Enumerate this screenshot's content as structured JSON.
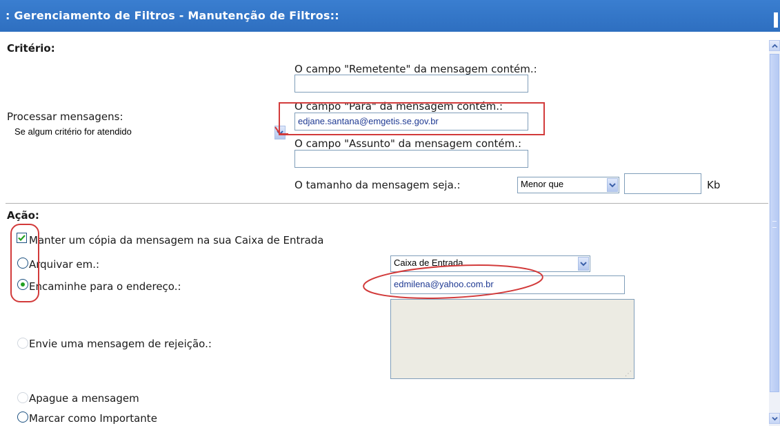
{
  "window": {
    "title": ": Gerenciamento de Filtros - Manutenção de Filtros::"
  },
  "criteria": {
    "header": "Critério:",
    "process_label": "Processar mensagens:",
    "process_value": "Se algum critério for atendido",
    "from_label": "O campo \"Remetente\" da mensagem contém.:",
    "from_value": "",
    "to_label": "O campo \"Para\" da mensagem contém.:",
    "to_value": "edjane.santana@emgetis.se.gov.br",
    "subject_label": "O campo \"Assunto\" da mensagem contém.:",
    "subject_value": "",
    "size_label": "O tamanho da mensagem seja.:",
    "size_comparator": "Menor que",
    "size_value": "",
    "size_unit": "Kb"
  },
  "action": {
    "header": "Ação:",
    "keep_copy_label": "Manter um cópia da mensagem na sua Caixa de Entrada",
    "keep_copy_checked": true,
    "archive_label": "Arquivar em.:",
    "archive_folder": "Caixa de Entrada",
    "forward_label": "Encaminhe para o endereço.:",
    "forward_selected": true,
    "forward_value": "edmilena@yahoo.com.br",
    "reject_label": "Envie uma mensagem de rejeição.:",
    "reject_text": "",
    "delete_label": "Apague a mensagem",
    "mark_important_label": "Marcar como Importante"
  },
  "annotations": {
    "color": "#d23a3a"
  },
  "colors": {
    "titlebar": "#2e6fc0",
    "input_text": "#1f3a93",
    "radio_selected": "#21a121"
  }
}
